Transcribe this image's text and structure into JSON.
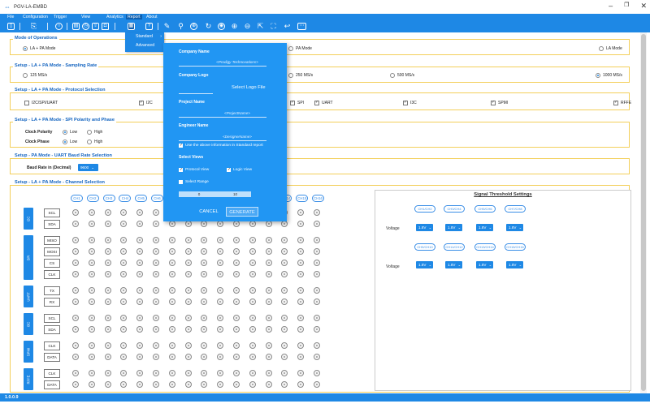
{
  "window": {
    "title": "PGV-LA-EMBD",
    "minimize": "–",
    "restore": "❐",
    "close": "✕"
  },
  "menu": [
    "File",
    "Configuration",
    "Trigger",
    "View",
    "Analytics",
    "Report",
    "About"
  ],
  "report_menu": {
    "items": [
      "Standard",
      "Advanced"
    ],
    "submenu_arrow": "›"
  },
  "toolbar_icons": [
    "open-icon",
    "copy-icon",
    "record-icon",
    "save-icon",
    "clock-icon",
    "export-icon",
    "camera-icon",
    "report-icon",
    "help-icon",
    "edit-icon",
    "marker-icon",
    "globe-icon",
    "refresh-icon",
    "compass-icon",
    "zoom-in-icon",
    "zoom-out-icon",
    "pointer-icon",
    "fit-icon",
    "undo-icon",
    "settings-icon"
  ],
  "mode": {
    "title": "Mode of Operations",
    "options": [
      "LA + PA Mode",
      "PA Mode",
      "LA Mode"
    ],
    "selected": "LA + PA Mode"
  },
  "sampling": {
    "title": "Setup - LA + PA Mode - Sampling Rate",
    "options": [
      "125 MS/s",
      "250 MS/s",
      "500 MS/s",
      "1000 MS/s"
    ],
    "selected": "1000 MS/s"
  },
  "protocol": {
    "title": "Setup - LA + PA Mode - Protocol Selection",
    "options": [
      {
        "label": "I2C/SPI/UART",
        "checked": false
      },
      {
        "label": "I2C",
        "checked": true
      },
      {
        "label": "SPI",
        "checked": true
      },
      {
        "label": "UART",
        "checked": true
      },
      {
        "label": "I3C",
        "checked": true
      },
      {
        "label": "SPMI",
        "checked": true
      },
      {
        "label": "RFFE",
        "checked": true
      }
    ]
  },
  "spi": {
    "title": "Setup - LA + PA Mode - SPI Polarity and Phase",
    "polarity_label": "Clock Polarity",
    "phase_label": "Clock Phase",
    "options": [
      "Low",
      "High"
    ],
    "polarity": "Low",
    "phase": "Low"
  },
  "uart": {
    "title": "Setup - PA Mode - UART Baud Rate Selection",
    "label": "Baud Rate in (Decimal)",
    "value": "9600"
  },
  "channels": {
    "title": "Setup - LA + PA Mode - Channel Selection",
    "headers": [
      "CH1",
      "CH2",
      "CH3",
      "CH4",
      "CH5",
      "CH6",
      "CH7",
      "CH8",
      "CH9",
      "CH10",
      "CH11",
      "CH12",
      "CH13",
      "CH14",
      "CH15",
      "CH16"
    ],
    "groups": [
      {
        "name": "I2C",
        "signals": [
          "SCL",
          "SDA"
        ]
      },
      {
        "name": "SPI",
        "signals": [
          "MISO",
          "MOSI",
          "CS",
          "CLK"
        ]
      },
      {
        "name": "UART",
        "signals": [
          "TX",
          "RX"
        ]
      },
      {
        "name": "I3C",
        "signals": [
          "SCL",
          "SDA"
        ]
      },
      {
        "name": "SPMI",
        "signals": [
          "CLK",
          "DATA"
        ]
      },
      {
        "name": "RFFE",
        "signals": [
          "CLK",
          "DATA"
        ]
      }
    ]
  },
  "threshold": {
    "title": "Signal Threshold Settings",
    "voltage_label": "Voltage",
    "row1": [
      "CH1/CH2",
      "CH3/CH4",
      "CH5/CH6",
      "CH7/CH8"
    ],
    "row2": [
      "CH9/CH10",
      "CH11/CH12",
      "CH13/CH14",
      "CH15/CH16"
    ],
    "values": [
      "1.8V",
      "1.8V",
      "1.8V",
      "1.8V",
      "1.8V",
      "1.8V",
      "1.8V",
      "1.8V"
    ]
  },
  "report_dialog": {
    "company_name_label": "Company Name",
    "company_name_value": "<Prodigy Technovations>",
    "company_logo_label": "Company Logo",
    "select_logo": "Select Logo File",
    "project_name_label": "Project Name",
    "project_name_value": "<ProjectName>",
    "engineer_name_label": "Engineer Name",
    "engineer_name_value": "<DesignerName>",
    "use_info_label": "Use the above information in Standard report",
    "select_views_label": "Select Views",
    "protocol_view": "Protocol View",
    "logic_view": "Logic View",
    "select_range": "Select Range",
    "range_from": "0",
    "range_to": "10",
    "cancel": "CANCEL",
    "generate": "GENERATE"
  },
  "status": {
    "version": "1.0.0.9"
  }
}
